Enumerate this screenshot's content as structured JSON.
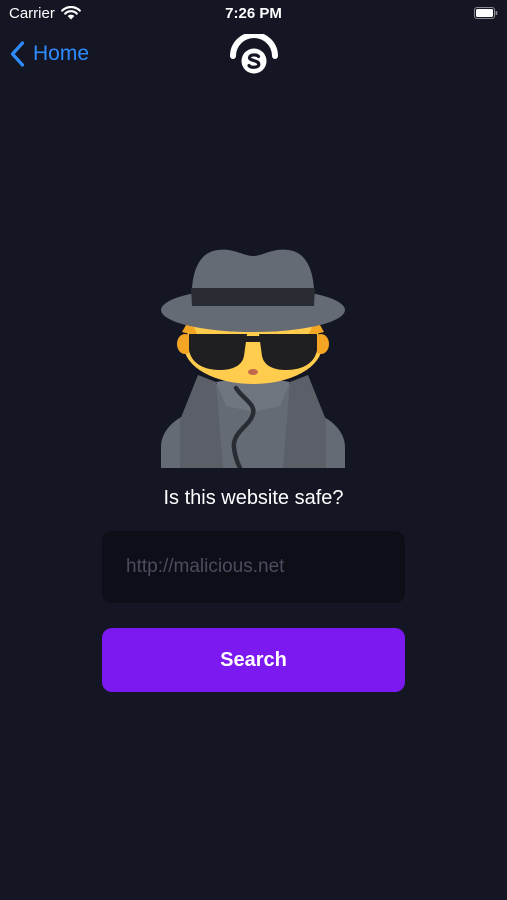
{
  "status_bar": {
    "carrier": "Carrier",
    "time": "7:26 PM"
  },
  "nav": {
    "back_label": "Home",
    "back_icon": "chevron-left-icon",
    "logo_icon": "app-logo-icon"
  },
  "hero": {
    "icon": "spy-detective-icon",
    "headline": "Is this website safe?"
  },
  "search": {
    "placeholder": "http://malicious.net",
    "value": "",
    "button_label": "Search"
  },
  "colors": {
    "background": "#141624",
    "accent": "#7b19f0",
    "link": "#2f8cff",
    "input_bg": "#0d0e17"
  }
}
